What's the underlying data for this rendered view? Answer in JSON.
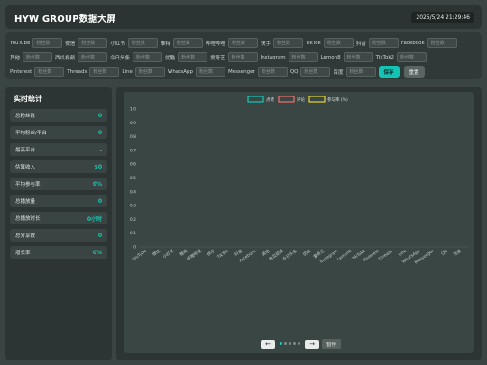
{
  "header": {
    "title": "HYW GROUP数据大屏",
    "datetime": "2025/5/24 21:29:46"
  },
  "form": {
    "placeholder": "粉丝数",
    "rows": [
      [
        "YouTube",
        "微信",
        "小红书",
        "推特",
        "哔哩哔哩",
        "快手",
        "TikTok",
        "抖音",
        "Facebook"
      ],
      [
        "其他",
        "西瓜视频",
        "今日头条",
        "优酷",
        "爱奇艺",
        "Instagram",
        "Lemon8",
        "TikTok2"
      ],
      [
        "Pinterest",
        "Threads",
        "Line",
        "WhatsApp",
        "Messenger",
        "QQ",
        "百度"
      ]
    ],
    "save_label": "保存",
    "reset_label": "重置"
  },
  "stats": {
    "title": "实时统计",
    "items": [
      {
        "label": "总粉丝数",
        "value": "0"
      },
      {
        "label": "平均粉丝/平台",
        "value": "0"
      },
      {
        "label": "最高平台",
        "value": "-"
      },
      {
        "label": "估算收入",
        "value": "$0"
      },
      {
        "label": "平均参与率",
        "value": "0%"
      },
      {
        "label": "总播放量",
        "value": "0"
      },
      {
        "label": "总播放时长",
        "value": "0小时"
      },
      {
        "label": "总分享数",
        "value": "0"
      },
      {
        "label": "增长率",
        "value": "0%"
      }
    ]
  },
  "chart_data": {
    "type": "bar",
    "categories": [
      "YouTube",
      "微信",
      "小红书",
      "推特",
      "哔哩哔哩",
      "快手",
      "TikTok",
      "抖音",
      "Facebook",
      "其他",
      "西瓜视频",
      "今日头条",
      "优酷",
      "爱奇艺",
      "Instagram",
      "Lemon8",
      "TikTok2",
      "Pinterest",
      "Threads",
      "Line",
      "WhatsApp",
      "Messenger",
      "QQ",
      "百度"
    ],
    "series": [
      {
        "name": "点赞",
        "color": "#14c9b7",
        "values": [
          0,
          0,
          0,
          0,
          0,
          0,
          0,
          0,
          0,
          0,
          0,
          0,
          0,
          0,
          0,
          0,
          0,
          0,
          0,
          0,
          0,
          0,
          0,
          0
        ]
      },
      {
        "name": "评论",
        "color": "#f07070",
        "values": [
          0,
          0,
          0,
          0,
          0,
          0,
          0,
          0,
          0,
          0,
          0,
          0,
          0,
          0,
          0,
          0,
          0,
          0,
          0,
          0,
          0,
          0,
          0,
          0
        ]
      },
      {
        "name": "参与率 (%)",
        "color": "#e8d23a",
        "values": [
          0,
          0,
          0,
          0,
          0,
          0,
          0,
          0,
          0,
          0,
          0,
          0,
          0,
          0,
          0,
          0,
          0,
          0,
          0,
          0,
          0,
          0,
          0,
          0
        ]
      }
    ],
    "yticks": [
      "0",
      "0.1",
      "0.2",
      "0.3",
      "0.4",
      "0.5",
      "0.6",
      "0.7",
      "0.8",
      "0.9",
      "1.0"
    ],
    "ylim": [
      0,
      1.0
    ],
    "legend": "top-center",
    "grid": false
  },
  "pager": {
    "prev": "←",
    "next": "→",
    "pause_label": "暂停",
    "dot_count": 5,
    "active_dot": 0
  }
}
